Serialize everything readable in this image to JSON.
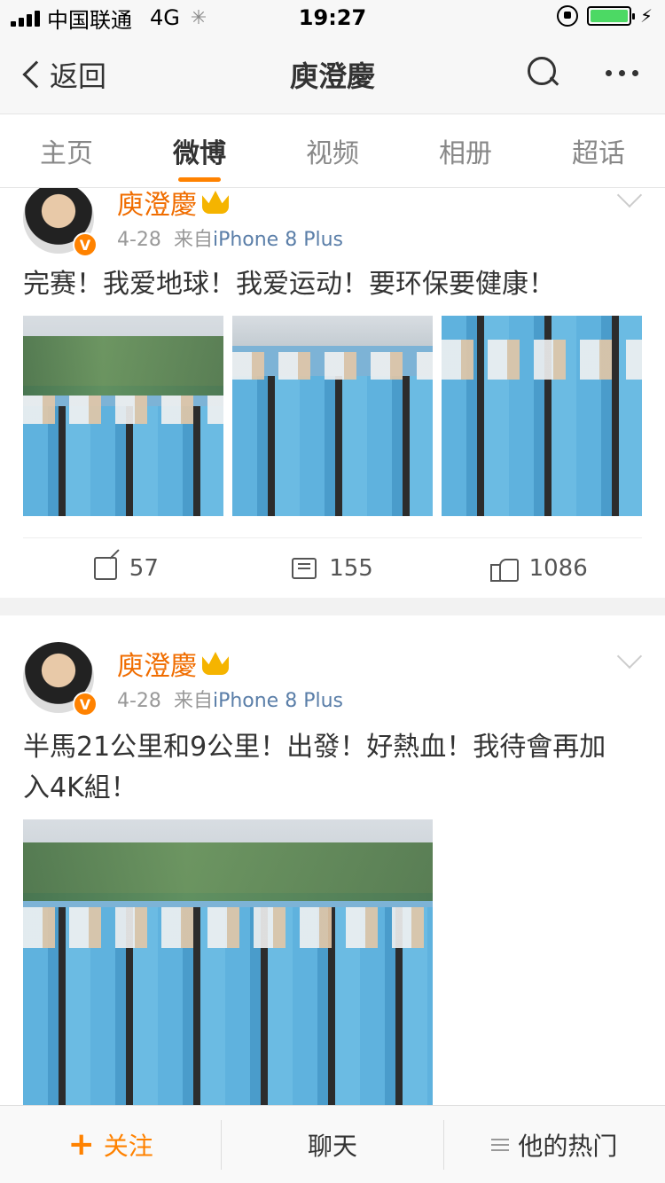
{
  "status_bar": {
    "carrier": "中国联通",
    "network": "4G",
    "time": "19:27"
  },
  "nav": {
    "back_label": "返回",
    "title": "庾澄慶"
  },
  "tabs": [
    {
      "label": "主页"
    },
    {
      "label": "微博"
    },
    {
      "label": "视频"
    },
    {
      "label": "相册"
    },
    {
      "label": "超话"
    }
  ],
  "active_tab": "微博",
  "posts": [
    {
      "username": "庾澄慶",
      "date": "4-28",
      "source_prefix": "来自",
      "source": "iPhone 8 Plus",
      "text": "完赛！我爱地球！我爱运动！要环保要健康！",
      "reposts": "57",
      "comments": "155",
      "likes": "1086"
    },
    {
      "username": "庾澄慶",
      "date": "4-28",
      "source_prefix": "来自",
      "source": "iPhone 8 Plus",
      "text": "半馬21公里和9公里！出發！好熱血！我待會再加入4K組！"
    }
  ],
  "bottom_bar": {
    "follow_label": "关注",
    "chat_label": "聊天",
    "hot_label": "他的热门"
  },
  "colors": {
    "accent": "#ff8200",
    "username": "#f06d00",
    "source_link": "#5a7ea8"
  }
}
